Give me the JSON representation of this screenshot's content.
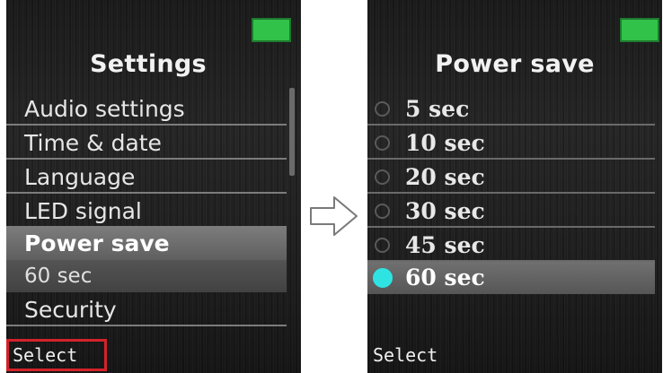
{
  "left_screen": {
    "title": "Settings",
    "menu_items": [
      {
        "label": "Audio settings"
      },
      {
        "label": "Time & date"
      },
      {
        "label": "Language"
      },
      {
        "label": "LED signal"
      },
      {
        "label": "Power save"
      },
      {
        "label": "60 sec"
      },
      {
        "label": "Security"
      }
    ],
    "softkey": "Select"
  },
  "right_screen": {
    "title": "Power save",
    "options": [
      {
        "label": "5 sec",
        "selected": false
      },
      {
        "label": "10 sec",
        "selected": false
      },
      {
        "label": "20 sec",
        "selected": false
      },
      {
        "label": "30 sec",
        "selected": false
      },
      {
        "label": "45 sec",
        "selected": false
      },
      {
        "label": "60 sec",
        "selected": true
      }
    ],
    "softkey": "Select"
  },
  "colors": {
    "battery": "#31c24a",
    "highlight_softkey_border": "#d4222a",
    "radio_selected": "#2fe3e3"
  },
  "icons": {
    "battery": "battery-icon",
    "arrow": "arrow-right-icon",
    "radio": "radio-button-icon"
  }
}
